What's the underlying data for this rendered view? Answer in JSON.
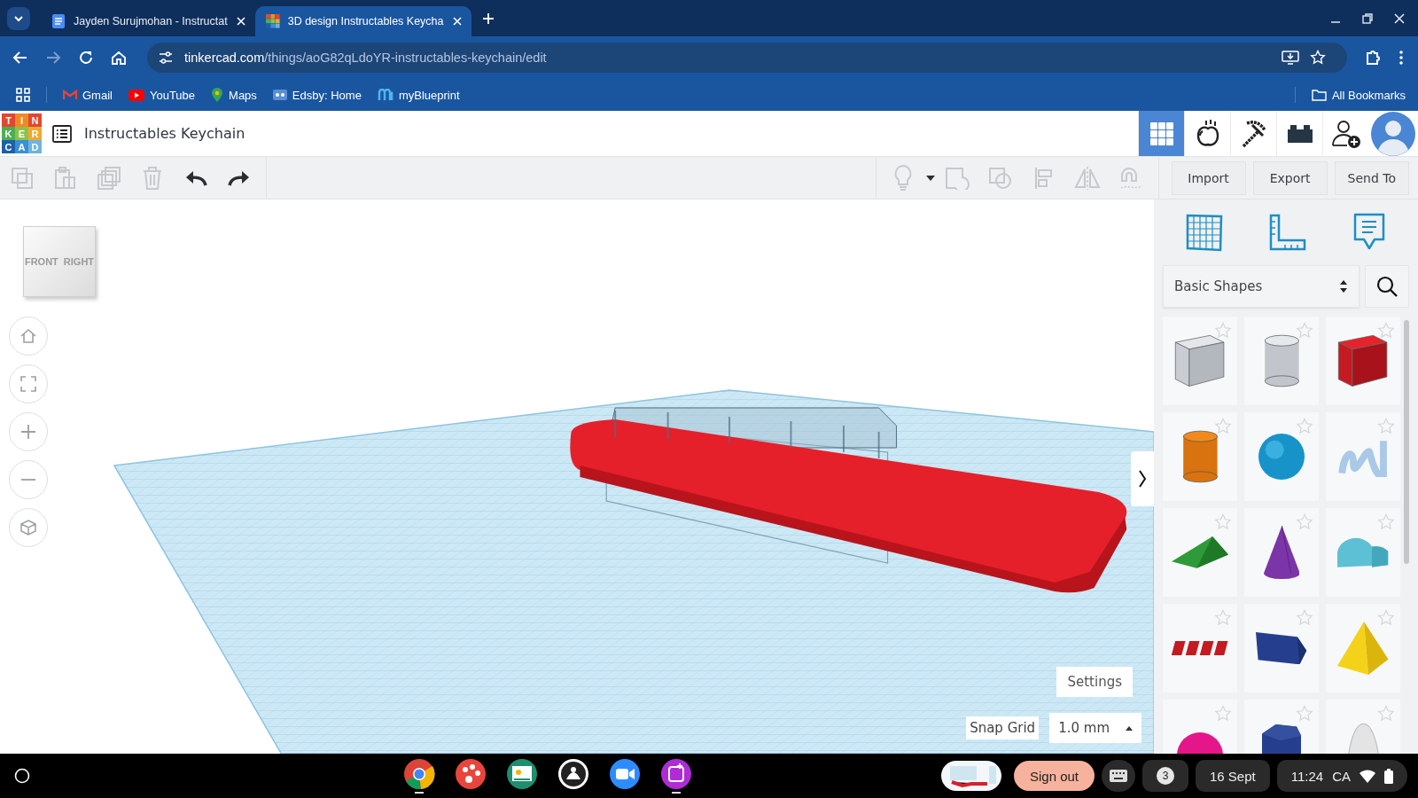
{
  "browser": {
    "tabs": [
      {
        "title": "Jayden Surujmohan - Instructat",
        "kind": "doc",
        "selected": false
      },
      {
        "title": "3D design Instructables Keycha",
        "kind": "tinkercad",
        "selected": true
      }
    ],
    "url": {
      "domain": "tinkercad.com",
      "path": "/things/aoG82qLdoYR-instructables-keychain/edit"
    },
    "bookmarks": [
      {
        "label": "Gmail",
        "kind": "gmail"
      },
      {
        "label": "YouTube",
        "kind": "youtube"
      },
      {
        "label": "Maps",
        "kind": "maps"
      },
      {
        "label": "Edsby: Home",
        "kind": "edsby"
      },
      {
        "label": "myBlueprint",
        "kind": "blueprint"
      }
    ],
    "all_bookmarks": "All Bookmarks"
  },
  "app": {
    "logo": [
      {
        "letter": "T",
        "color": "#e2472f"
      },
      {
        "letter": "I",
        "color": "#f08a24"
      },
      {
        "letter": "N",
        "color": "#e2472f"
      },
      {
        "letter": "K",
        "color": "#4caf50"
      },
      {
        "letter": "E",
        "color": "#8bc34a"
      },
      {
        "letter": "R",
        "color": "#f0a830"
      },
      {
        "letter": "C",
        "color": "#1d5fa8"
      },
      {
        "letter": "A",
        "color": "#3a8fd6"
      },
      {
        "letter": "D",
        "color": "#6fb3e0"
      }
    ],
    "design_title": "Instructables Keychain",
    "views": [
      {
        "kind": "grid",
        "selected": true
      },
      {
        "kind": "apple",
        "selected": false
      },
      {
        "kind": "pickaxe",
        "selected": false
      },
      {
        "kind": "brick",
        "selected": false
      },
      {
        "kind": "add-user",
        "selected": false
      }
    ],
    "tools": [
      {
        "kind": "copy",
        "disabled": true
      },
      {
        "kind": "paste",
        "disabled": true
      },
      {
        "kind": "duplicate",
        "disabled": true
      },
      {
        "kind": "delete",
        "disabled": true
      },
      {
        "kind": "undo",
        "disabled": false
      },
      {
        "kind": "redo",
        "disabled": false
      }
    ],
    "shape_tools": [
      {
        "kind": "bulb",
        "disabled": true
      },
      {
        "kind": "group",
        "disabled": true
      },
      {
        "kind": "ungroup",
        "disabled": true
      },
      {
        "kind": "align",
        "disabled": true
      },
      {
        "kind": "mirror",
        "disabled": true
      },
      {
        "kind": "magnet",
        "disabled": true
      }
    ],
    "actions": [
      "Import",
      "Export",
      "Send To"
    ],
    "viewcube": {
      "front": "FRONT",
      "right": "RIGHT"
    },
    "settings": "Settings",
    "snap": {
      "label": "Snap Grid",
      "value": "1.0 mm"
    },
    "panel": {
      "category": "Basic Shapes",
      "shapes": [
        {
          "kind": "box-hole",
          "starred": false
        },
        {
          "kind": "cylinder-hole",
          "starred": false
        },
        {
          "kind": "box",
          "starred": false
        },
        {
          "kind": "cylinder",
          "starred": false
        },
        {
          "kind": "sphere",
          "starred": false
        },
        {
          "kind": "scribble",
          "starred": false
        },
        {
          "kind": "roof",
          "starred": false
        },
        {
          "kind": "cone",
          "starred": false
        },
        {
          "kind": "round-roof",
          "starred": false
        },
        {
          "kind": "text",
          "starred": false
        },
        {
          "kind": "polygon",
          "starred": false
        },
        {
          "kind": "pyramid",
          "starred": false
        },
        {
          "kind": "half-sphere",
          "starred": false
        },
        {
          "kind": "hexagon",
          "starred": false
        },
        {
          "kind": "paraboloid",
          "starred": false
        }
      ]
    }
  },
  "taskbar": {
    "apps": [
      {
        "kind": "chrome",
        "open": true
      },
      {
        "kind": "paint",
        "open": false
      },
      {
        "kind": "classroom",
        "open": false
      },
      {
        "kind": "kindle",
        "open": false
      },
      {
        "kind": "zoom",
        "open": false
      },
      {
        "kind": "purple-app",
        "open": true
      }
    ],
    "sign_out": "Sign out",
    "notifications": "3",
    "date": "16 Sept",
    "time": "11:24",
    "region": "CA"
  }
}
